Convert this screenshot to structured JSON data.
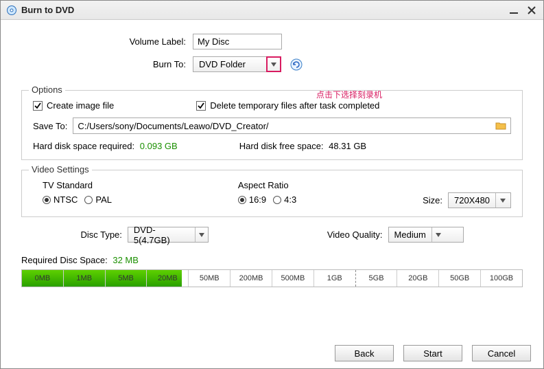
{
  "window": {
    "title": "Burn to DVD"
  },
  "volume_label": {
    "label": "Volume Label:",
    "value": "My Disc"
  },
  "burn_to": {
    "label": "Burn To:",
    "value": "DVD Folder",
    "hint": "点击下选择刻录机"
  },
  "options": {
    "legend": "Options",
    "create_image": "Create image file",
    "delete_temp": "Delete temporary files after task completed",
    "save_to_label": "Save To:",
    "save_to_path": "C:/Users/sony/Documents/Leawo/DVD_Creator/",
    "hd_req_label": "Hard disk space required:",
    "hd_req_value": "0.093 GB",
    "hd_free_label": "Hard disk free space:",
    "hd_free_value": "48.31 GB"
  },
  "video_settings": {
    "legend": "Video Settings",
    "tv_standard_label": "TV Standard",
    "ntsc": "NTSC",
    "pal": "PAL",
    "aspect_ratio_label": "Aspect Ratio",
    "r169": "16:9",
    "r43": "4:3",
    "size_label": "Size:",
    "size_value": "720X480"
  },
  "middle": {
    "disc_type_label": "Disc Type:",
    "disc_type_value": "DVD-5(4.7GB)",
    "video_quality_label": "Video Quality:",
    "video_quality_value": "Medium"
  },
  "req_space": {
    "label": "Required Disc Space:",
    "value": "32 MB"
  },
  "ticks": {
    "t0": "0MB",
    "t1": "1MB",
    "t2": "5MB",
    "t3": "20MB",
    "t4": "50MB",
    "t5": "200MB",
    "t6": "500MB",
    "t7": "1GB",
    "t8": "5GB",
    "t9": "20GB",
    "t10": "50GB",
    "t11": "100GB"
  },
  "buttons": {
    "back": "Back",
    "start": "Start",
    "cancel": "Cancel"
  }
}
